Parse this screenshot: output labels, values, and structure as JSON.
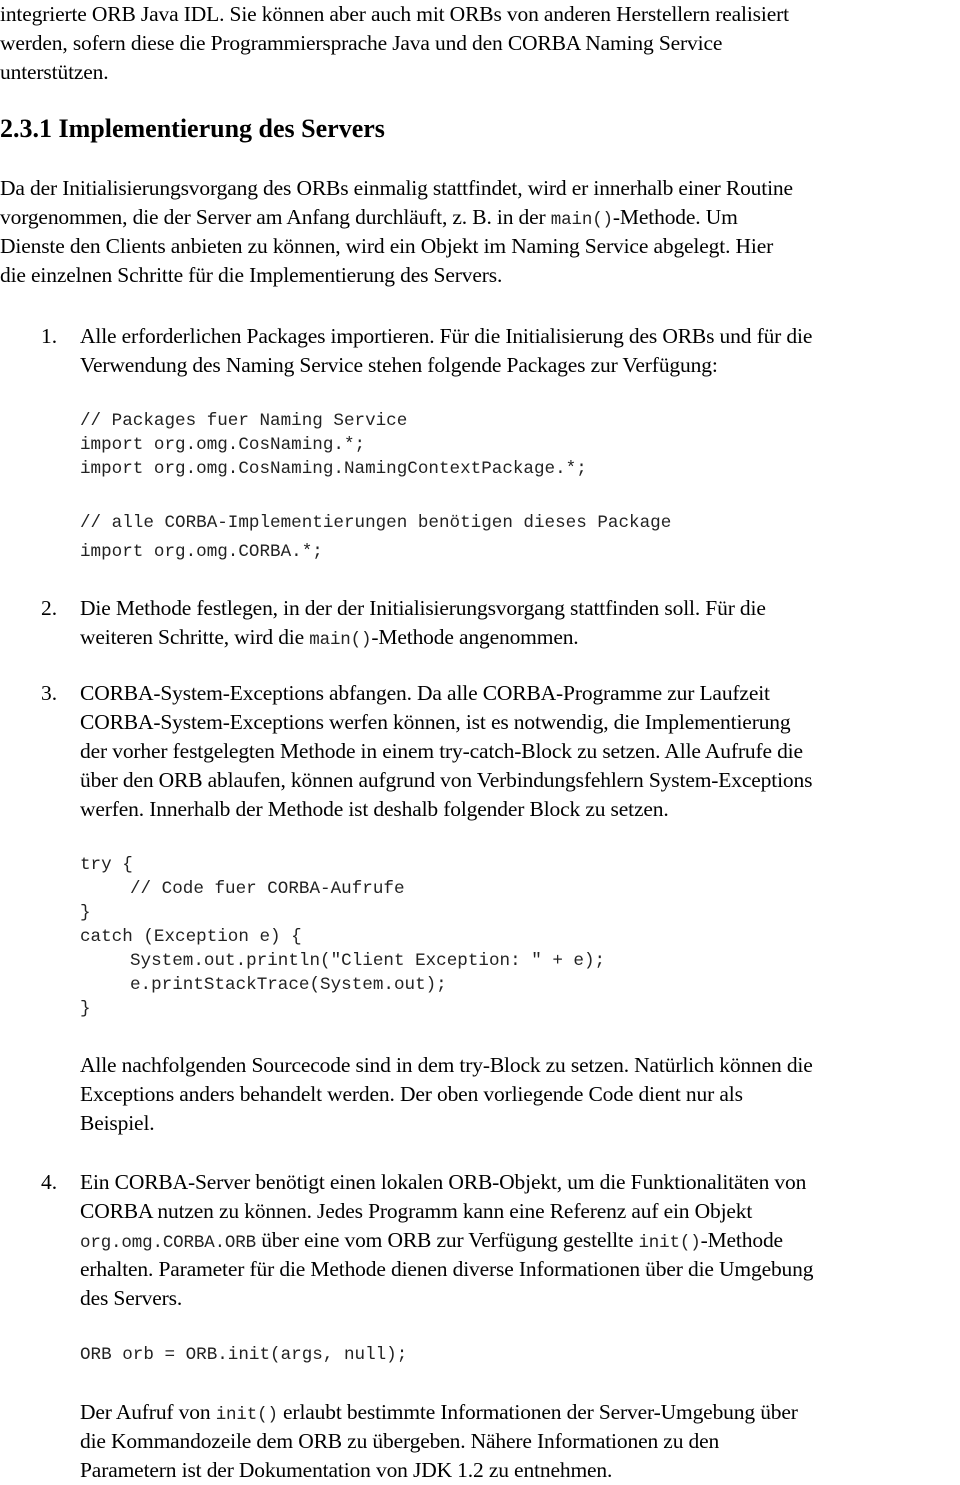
{
  "intro": {
    "lines": [
      "integrierte ORB Java IDL. Sie können aber auch mit ORBs von anderen Herstellern realisiert",
      "werden, sofern diese die Programmiersprache Java und den CORBA Naming Service",
      "unterstützen."
    ]
  },
  "section": {
    "heading": "2.3.1 Implementierung des Servers",
    "paragraph": {
      "line1": "Da der Initialisierungsvorgang des ORBs einmalig stattfindet, wird er innerhalb einer Routine",
      "line2_pre": "vorgenommen, die der Server am Anfang durchläuft, z. B. in der ",
      "line2_code": "main()",
      "line2_post": "-Methode. Um",
      "line3": "Dienste den Clients anbieten zu können, wird ein Objekt im Naming Service abgelegt. Hier",
      "line4": "die einzelnen Schritte für die Implementierung des Servers."
    }
  },
  "steps": [
    {
      "number": "1.",
      "lines": [
        "Alle erforderlichen Packages importieren. Für die Initialisierung des ORBs und für die",
        "Verwendung des Naming Service stehen folgende Packages zur Verfügung:"
      ],
      "code_block_1": [
        "// Packages fuer Naming Service",
        "import org.omg.CosNaming.*;",
        "import org.omg.CosNaming.NamingContextPackage.*;"
      ],
      "code_block_2": [
        "// alle CORBA-Implementierungen benötigen dieses Package",
        "import org.omg.CORBA.*;"
      ]
    },
    {
      "number": "2.",
      "line1": "Die Methode festlegen, in der der Initialisierungsvorgang stattfinden soll. Für die",
      "line2_pre": "weiteren Schritte, wird die ",
      "line2_code": "main()",
      "line2_post": "-Methode angenommen."
    },
    {
      "number": "3.",
      "lines": [
        "CORBA-System-Exceptions abfangen. Da alle CORBA-Programme zur Laufzeit",
        "CORBA-System-Exceptions werfen können, ist es notwendig, die Implementierung",
        "der vorher festgelegten Methode in einem try-catch-Block zu setzen. Alle Aufrufe die",
        "über den ORB ablaufen, können aufgrund von Verbindungsfehlern System-Exceptions",
        "werfen. Innerhalb der Methode ist deshalb folgender Block zu setzen."
      ],
      "code": [
        "try {",
        "// Code fuer CORBA-Aufrufe",
        "}",
        "catch (Exception e) {",
        "System.out.println(\"Client Exception: \" + e);",
        "e.printStackTrace(System.out);",
        "}"
      ],
      "after_lines": [
        "Alle nachfolgenden Sourcecode sind in dem try-Block zu setzen. Natürlich können die",
        "Exceptions anders behandelt werden. Der oben vorliegende Code dient nur als",
        "Beispiel."
      ]
    },
    {
      "number": "4.",
      "line1": "Ein CORBA-Server benötigt einen lokalen ORB-Objekt, um die Funktionalitäten von",
      "line2": "CORBA nutzen zu können. Jedes Programm kann eine Referenz auf ein Objekt",
      "line3_code1": "org.omg.CORBA.ORB",
      "line3_mid": " über eine vom ORB zur Verfügung gestellte ",
      "line3_code2": "init()",
      "line3_post": "-Methode",
      "line4": "erhalten. Parameter für die Methode dienen diverse Informationen über die Umgebung",
      "line5": "des Servers.",
      "code": "ORB orb = ORB.init(args, null);",
      "after_line1_pre": "Der Aufruf von ",
      "after_line1_code": "init()",
      "after_line1_post": " erlaubt bestimmte Informationen der Server-Umgebung über",
      "after_line2": "die Kommandozeile dem ORB zu übergeben. Nähere Informationen zu den",
      "after_line3": "Parametern ist der Dokumentation von JDK 1.2 zu entnehmen."
    }
  ]
}
